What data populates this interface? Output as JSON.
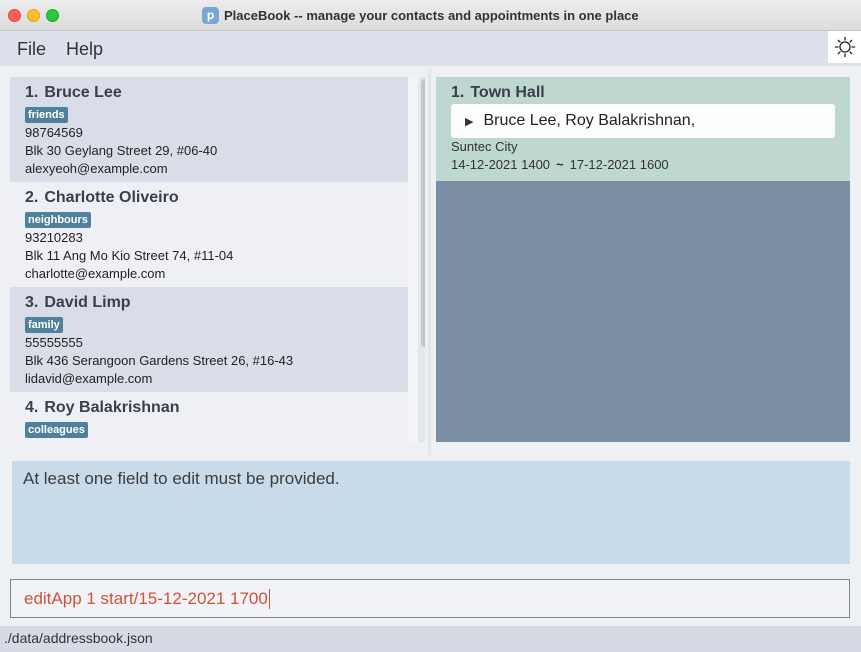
{
  "window": {
    "title": "PlaceBook -- manage your contacts and appointments in one place",
    "icon_letter": "p"
  },
  "menu": {
    "file": "File",
    "help": "Help"
  },
  "theme_toggle_icon": "sun-icon",
  "persons": [
    {
      "index": "1.",
      "name": "Bruce Lee",
      "tag": "friends",
      "phone": "98764569",
      "address": "Blk 30 Geylang Street 29, #06-40",
      "email": "alexyeoh@example.com"
    },
    {
      "index": "2.",
      "name": "Charlotte Oliveiro",
      "tag": "neighbours",
      "phone": "93210283",
      "address": "Blk 11 Ang Mo Kio Street 74, #11-04",
      "email": "charlotte@example.com"
    },
    {
      "index": "3.",
      "name": "David Limp",
      "tag": "family",
      "phone": "55555555",
      "address": "Blk 436 Serangoon Gardens Street 26, #16-43",
      "email": "lidavid@example.com"
    },
    {
      "index": "4.",
      "name": "Roy Balakrishnan",
      "tag": "colleagues"
    }
  ],
  "appointments": [
    {
      "index": "1.",
      "title": "Town Hall",
      "people": "Bruce Lee, Roy Balakrishnan,",
      "location": "Suntec City",
      "start": "14-12-2021 1400",
      "separator": "~",
      "end": "17-12-2021 1600"
    }
  ],
  "result": {
    "message": "At least one field to edit must be provided."
  },
  "command": {
    "value": "editApp 1 start/15-12-2021 1700"
  },
  "status": {
    "file_path": "./data/addressbook.json"
  },
  "colors": {
    "tag_bg": "#4f819b",
    "command_text": "#d0513c",
    "result_bg": "#c7dbeb",
    "appointment_card_bg": "#bfd7d1",
    "appointment_panel_bg": "#7a8fa3"
  }
}
